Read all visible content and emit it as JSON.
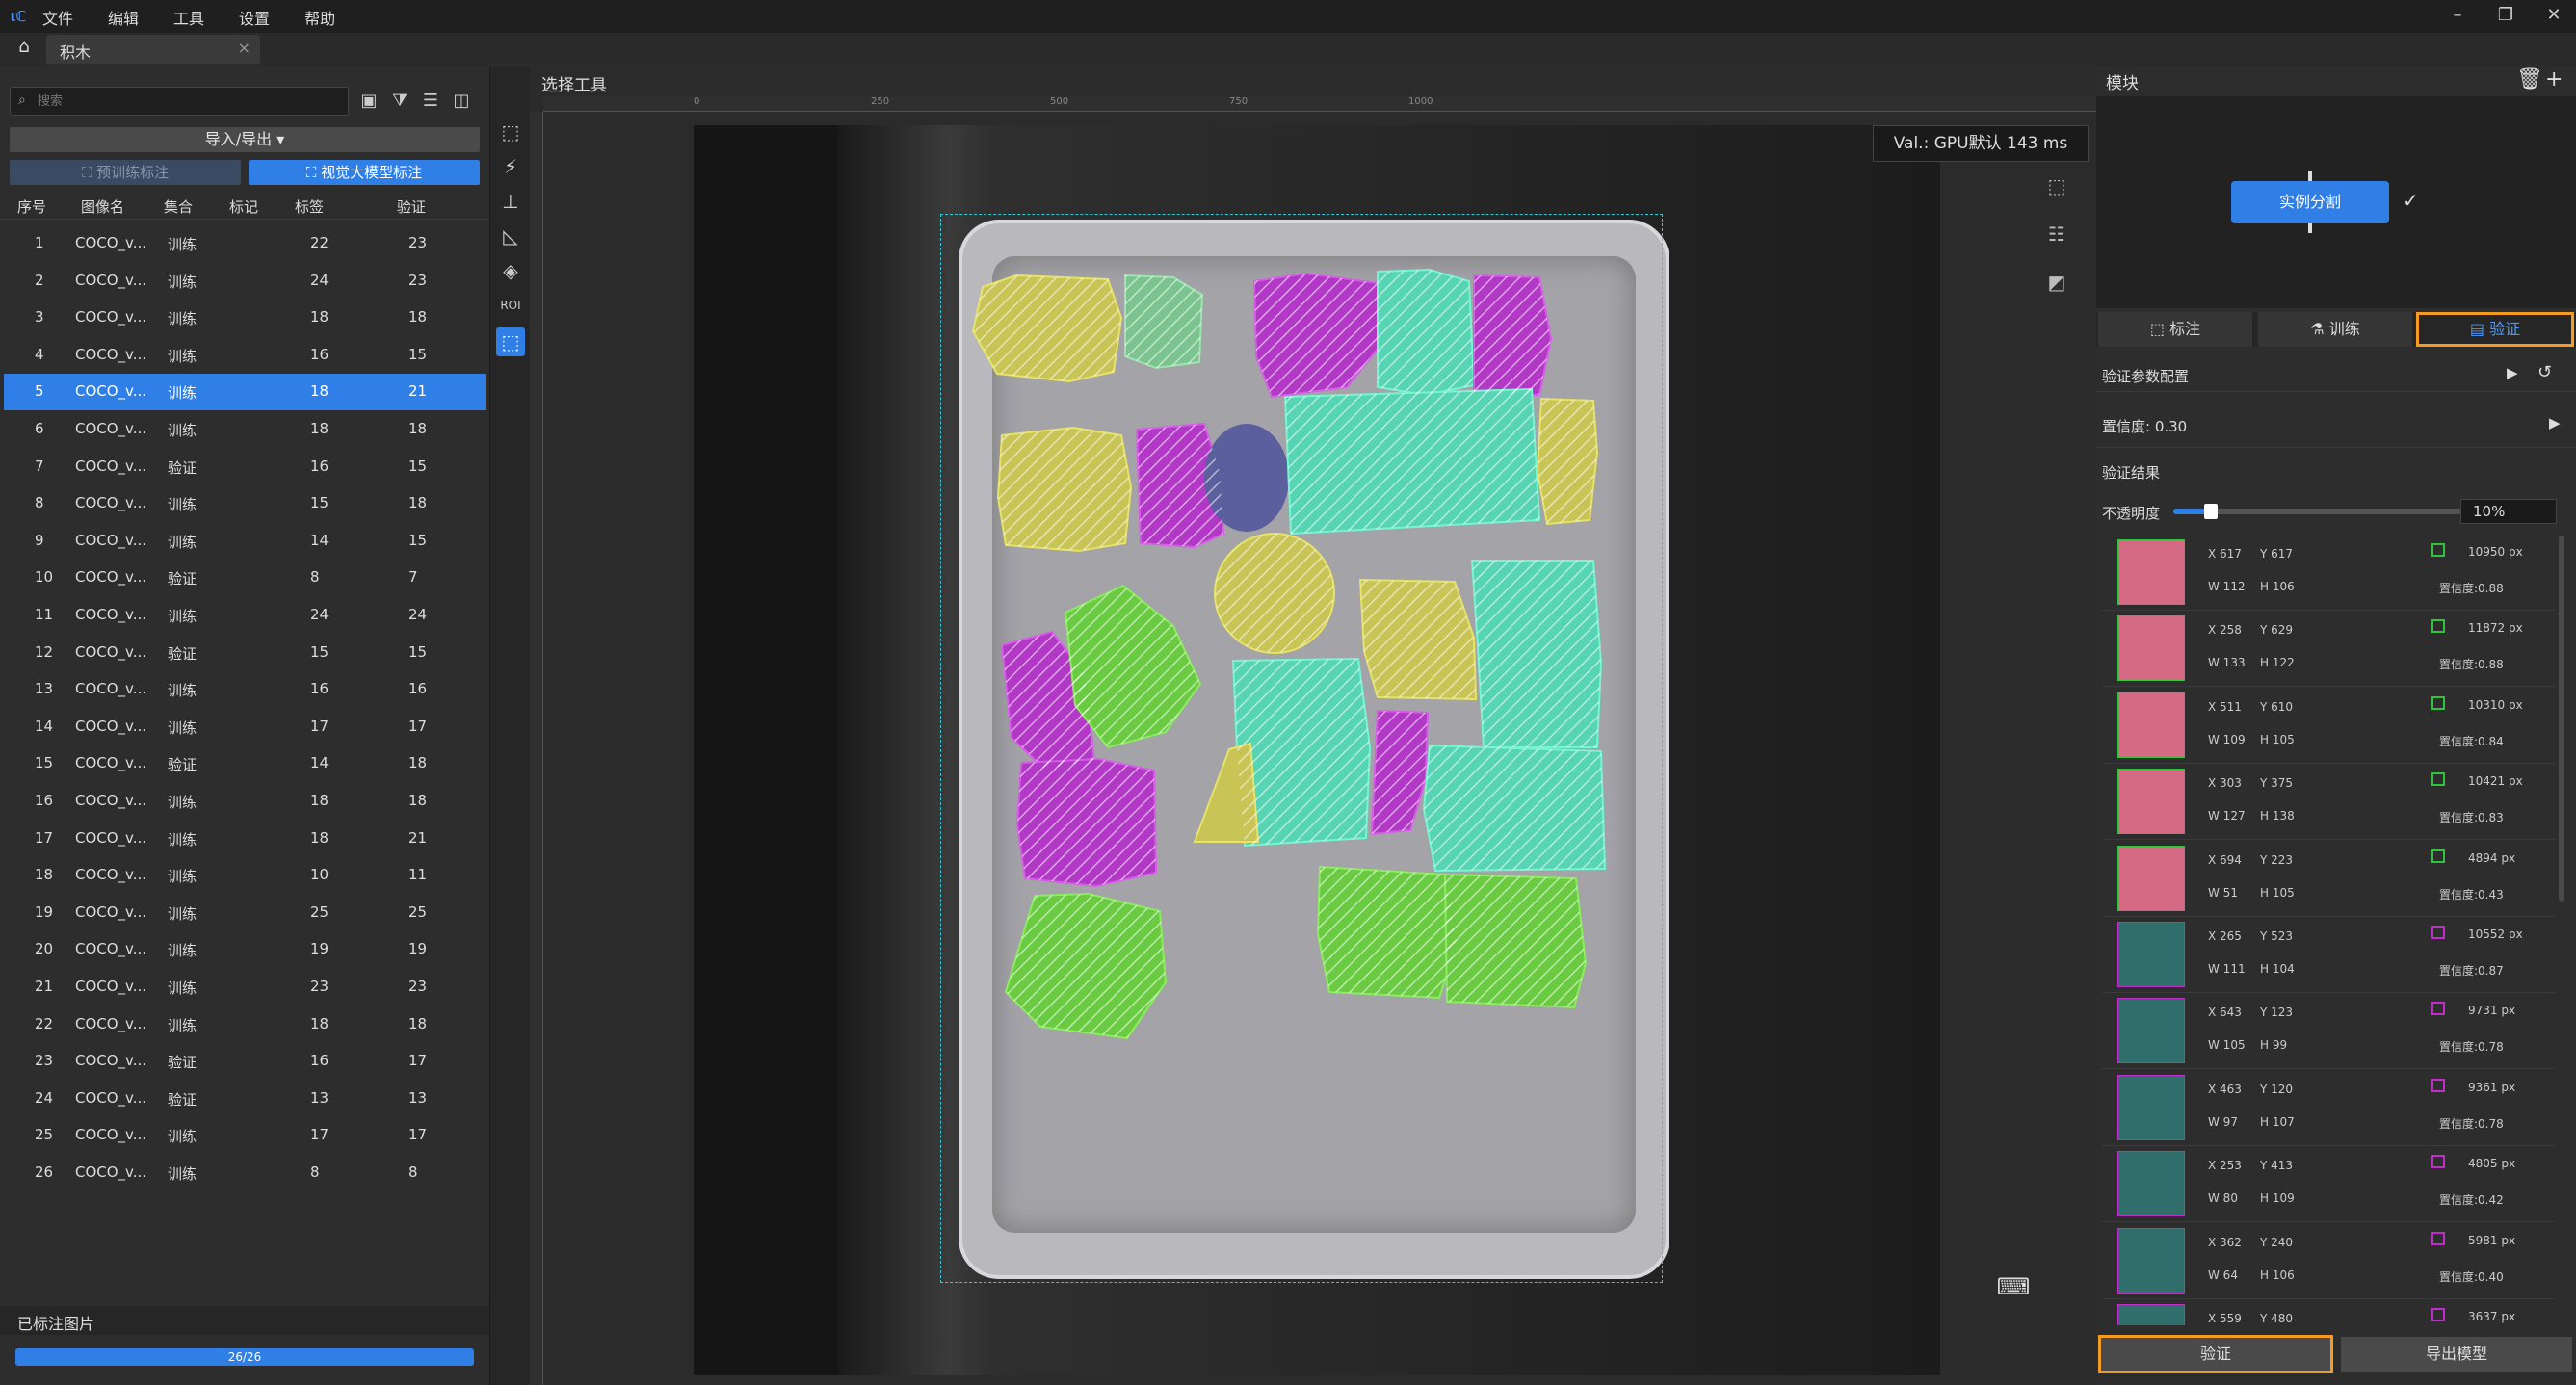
{
  "menu": [
    "文件",
    "编辑",
    "工具",
    "设置",
    "帮助"
  ],
  "tab": {
    "title": "积木",
    "close": "×"
  },
  "left": {
    "search_placeholder": "搜索",
    "import_export": "导入/导出 ▾",
    "pretrain_label": "预训练标注",
    "vlm_label": "视觉大模型标注",
    "headers": [
      "序号",
      "图像名",
      "集合",
      "标记",
      "标签",
      "验证"
    ],
    "rows": [
      [
        "1",
        "COCO_v...",
        "训练",
        "",
        "22",
        "23"
      ],
      [
        "2",
        "COCO_v...",
        "训练",
        "",
        "24",
        "23"
      ],
      [
        "3",
        "COCO_v...",
        "训练",
        "",
        "18",
        "18"
      ],
      [
        "4",
        "COCO_v...",
        "训练",
        "",
        "16",
        "15"
      ],
      [
        "5",
        "COCO_v...",
        "训练",
        "",
        "18",
        "21"
      ],
      [
        "6",
        "COCO_v...",
        "训练",
        "",
        "18",
        "18"
      ],
      [
        "7",
        "COCO_v...",
        "验证",
        "",
        "16",
        "15"
      ],
      [
        "8",
        "COCO_v...",
        "训练",
        "",
        "15",
        "18"
      ],
      [
        "9",
        "COCO_v...",
        "训练",
        "",
        "14",
        "15"
      ],
      [
        "10",
        "COCO_v...",
        "验证",
        "",
        "8",
        "7"
      ],
      [
        "11",
        "COCO_v...",
        "训练",
        "",
        "24",
        "24"
      ],
      [
        "12",
        "COCO_v...",
        "验证",
        "",
        "15",
        "15"
      ],
      [
        "13",
        "COCO_v...",
        "训练",
        "",
        "16",
        "16"
      ],
      [
        "14",
        "COCO_v...",
        "训练",
        "",
        "17",
        "17"
      ],
      [
        "15",
        "COCO_v...",
        "验证",
        "",
        "14",
        "18"
      ],
      [
        "16",
        "COCO_v...",
        "训练",
        "",
        "18",
        "18"
      ],
      [
        "17",
        "COCO_v...",
        "训练",
        "",
        "18",
        "21"
      ],
      [
        "18",
        "COCO_v...",
        "训练",
        "",
        "10",
        "11"
      ],
      [
        "19",
        "COCO_v...",
        "训练",
        "",
        "25",
        "25"
      ],
      [
        "20",
        "COCO_v...",
        "训练",
        "",
        "19",
        "19"
      ],
      [
        "21",
        "COCO_v...",
        "训练",
        "",
        "23",
        "23"
      ],
      [
        "22",
        "COCO_v...",
        "训练",
        "",
        "18",
        "18"
      ],
      [
        "23",
        "COCO_v...",
        "验证",
        "",
        "16",
        "17"
      ],
      [
        "24",
        "COCO_v...",
        "验证",
        "",
        "13",
        "13"
      ],
      [
        "25",
        "COCO_v...",
        "训练",
        "",
        "17",
        "17"
      ],
      [
        "26",
        "COCO_v...",
        "训练",
        "",
        "8",
        "8"
      ]
    ],
    "selected_index": 4,
    "labelled_title": "已标注图片",
    "progress_text": "26/26",
    "progress_value": 1.0
  },
  "center": {
    "title": "选择工具",
    "ruler_labels": [
      "0",
      "250",
      "500",
      "750",
      "1000"
    ],
    "val_text": "Val.: GPU默认 143 ms"
  },
  "right": {
    "title": "模块",
    "module_label": "实例分割",
    "tabs": [
      "标注",
      "训练",
      "验证"
    ],
    "config_label": "验证参数配置",
    "confidence_label": "置信度: 0.30",
    "results_label": "验证结果",
    "opacity_label": "不透明度",
    "opacity_value": "10%",
    "results": [
      {
        "x": "X 617",
        "y": "Y 617",
        "w": "W 112",
        "h": "H 106",
        "area": "10950 px",
        "conf": "置信度:0.88",
        "color": "#2ec53c"
      },
      {
        "x": "X 258",
        "y": "Y 629",
        "w": "W 133",
        "h": "H 122",
        "area": "11872 px",
        "conf": "置信度:0.88",
        "color": "#2ec53c"
      },
      {
        "x": "X 511",
        "y": "Y 610",
        "w": "W 109",
        "h": "H 105",
        "area": "10310 px",
        "conf": "置信度:0.84",
        "color": "#2ec53c"
      },
      {
        "x": "X 303",
        "y": "Y 375",
        "w": "W 127",
        "h": "H 138",
        "area": "10421 px",
        "conf": "置信度:0.83",
        "color": "#2ec53c"
      },
      {
        "x": "X 694",
        "y": "Y 223",
        "w": "W 51",
        "h": "H 105",
        "area": "4894 px",
        "conf": "置信度:0.43",
        "color": "#2ec53c"
      },
      {
        "x": "X 265",
        "y": "Y 523",
        "w": "W 111",
        "h": "H 104",
        "area": "10552 px",
        "conf": "置信度:0.87",
        "color": "#c12ccb"
      },
      {
        "x": "X 643",
        "y": "Y 123",
        "w": "W 105",
        "h": "H 99",
        "area": "9731 px",
        "conf": "置信度:0.78",
        "color": "#c12ccb"
      },
      {
        "x": "X 463",
        "y": "Y 120",
        "w": "W 97",
        "h": "H 107",
        "area": "9361 px",
        "conf": "置信度:0.78",
        "color": "#c12ccb"
      },
      {
        "x": "X 253",
        "y": "Y 413",
        "w": "W 80",
        "h": "H 109",
        "area": "4805 px",
        "conf": "置信度:0.42",
        "color": "#c12ccb"
      },
      {
        "x": "X 362",
        "y": "Y 240",
        "w": "W 64",
        "h": "H 106",
        "area": "5981 px",
        "conf": "置信度:0.40",
        "color": "#c12ccb"
      },
      {
        "x": "X 559",
        "y": "Y 480",
        "w": "",
        "h": "",
        "area": "3637 px",
        "conf": "",
        "color": "#c12ccb"
      }
    ],
    "validate_btn": "验证",
    "export_btn": "导出模型"
  }
}
